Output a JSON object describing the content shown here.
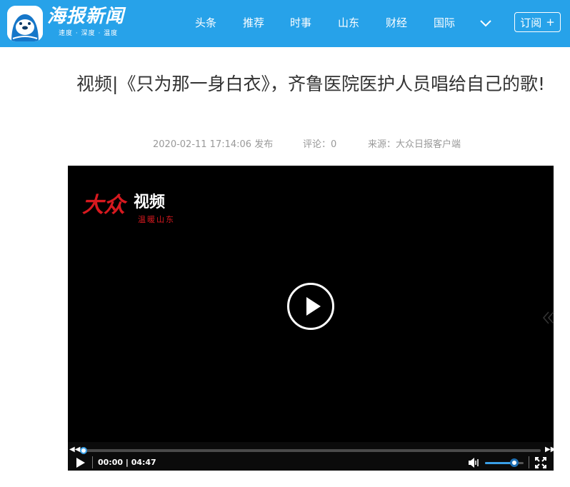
{
  "header": {
    "brand": "海报新闻",
    "slogan": "速度 · 深度 · 温度",
    "nav": [
      {
        "label": "头条"
      },
      {
        "label": "推荐"
      },
      {
        "label": "时事"
      },
      {
        "label": "山东"
      },
      {
        "label": "财经"
      },
      {
        "label": "国际"
      }
    ],
    "more_icon": "chevron-down-icon",
    "subscribe_label": "订阅",
    "subscribe_plus": "+"
  },
  "article": {
    "title": "视频|《只为那一身白衣》，齐鲁医院医护人员唱给自己的歌!",
    "published": "2020-02-11 17:14:06 发布",
    "comments": "评论：0",
    "source": "来源：大众日报客户端"
  },
  "video": {
    "logo_main": "大众",
    "logo_sub": "视频",
    "logo_tag": "温暖山东",
    "time_display": "00:00 | 04:47",
    "current_time": "00:00",
    "duration": "04:47",
    "progress": 0.0,
    "volume": 0.75
  },
  "colors": {
    "header_bg": "#27a2e9",
    "accent": "#3aa0e8",
    "video_bg": "#000000",
    "logo_red": "#d7191f"
  }
}
